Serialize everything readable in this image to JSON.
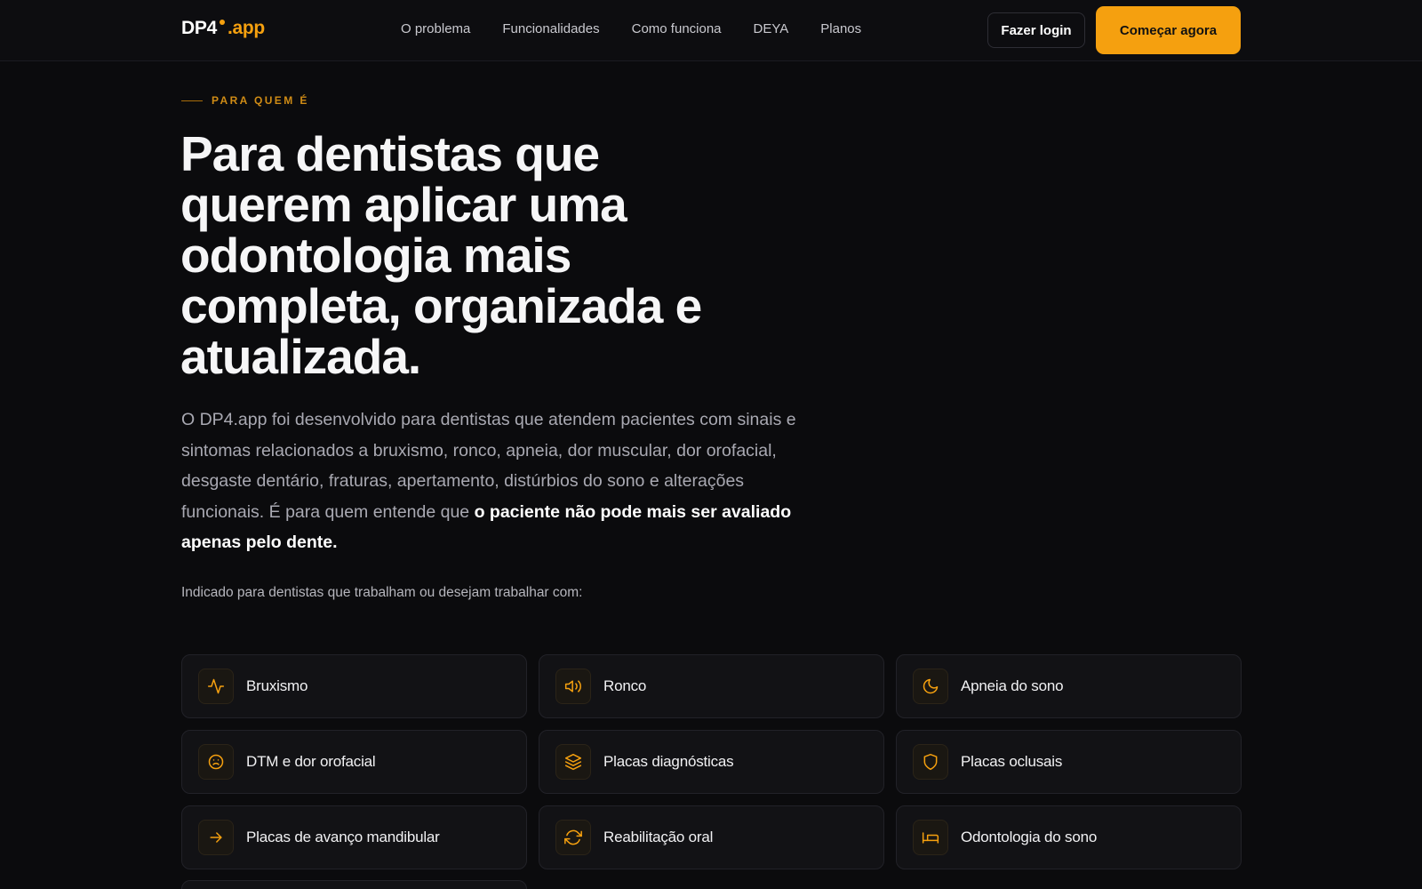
{
  "brand": {
    "name_main": "DP4",
    "name_suffix": ".app",
    "accent": "#f5a00f"
  },
  "nav": {
    "links": [
      "O problema",
      "Funcionalidades",
      "Como funciona",
      "DEYA",
      "Planos"
    ],
    "login_label": "Fazer login",
    "cta_label": "Começar agora"
  },
  "hero": {
    "eyebrow": "PARA QUEM É",
    "title": "Para dentistas que querem aplicar uma odontologia mais completa, organizada e atualizada.",
    "description": "O DP4.app foi desenvolvido para dentistas que atendem pacientes com sinais e sintomas relacionados a bruxismo, ronco, apneia, dor muscular, dor orofacial, desgaste dentário, fraturas, apertamento, distúrbios do sono e alterações funcionais. É para quem entende que ",
    "description_strong": "o paciente não pode mais ser avaliado apenas pelo dente.",
    "indicated": "Indicado para dentistas que trabalham ou desejam trabalhar com:"
  },
  "cards": [
    {
      "label": "Bruxismo",
      "icon": "activity-icon"
    },
    {
      "label": "Ronco",
      "icon": "speaker-icon"
    },
    {
      "label": "Apneia do sono",
      "icon": "moon-icon"
    },
    {
      "label": "DTM e dor orofacial",
      "icon": "frown-icon"
    },
    {
      "label": "Placas diagnósticas",
      "icon": "layers-icon"
    },
    {
      "label": "Placas oclusais",
      "icon": "shield-icon"
    },
    {
      "label": "Placas de avanço mandibular",
      "icon": "arrow-right-icon"
    },
    {
      "label": "Reabilitação oral",
      "icon": "refresh-icon"
    },
    {
      "label": "Odontologia do sono",
      "icon": "bed-icon"
    }
  ]
}
